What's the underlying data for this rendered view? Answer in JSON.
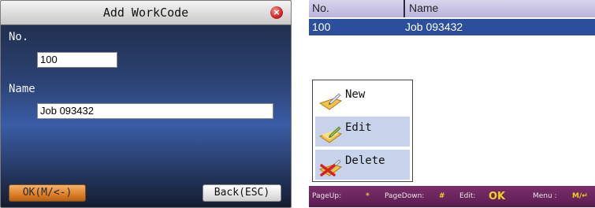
{
  "dialog": {
    "title": "Add WorkCode",
    "no_label": "No.",
    "no_value": "100",
    "name_label": "Name",
    "name_value": "Job 093432",
    "ok_button": "OK(M/<-)",
    "back_button": "Back(ESC)",
    "close_icon": "×"
  },
  "table": {
    "columns": [
      "No.",
      "Name"
    ],
    "rows": [
      {
        "no": "100",
        "name": "Job 093432"
      }
    ]
  },
  "menu": {
    "items": [
      {
        "label": "New",
        "icon": "new-icon"
      },
      {
        "label": "Edit",
        "icon": "edit-icon"
      },
      {
        "label": "Delete",
        "icon": "delete-icon"
      }
    ]
  },
  "footer": {
    "pageup_label": "PageUp:",
    "pageup_key": "*",
    "pagedown_label": "PageDown:",
    "pagedown_key": "#",
    "edit_label": "Edit:",
    "edit_key": "OK",
    "menu_label": "Menu :",
    "menu_key": "M/↵"
  },
  "colors": {
    "selected_row": "#2b4f9c",
    "ok_button": "#e0832a",
    "footer_bg": "#6a2560",
    "footer_key": "#f4d21c"
  }
}
